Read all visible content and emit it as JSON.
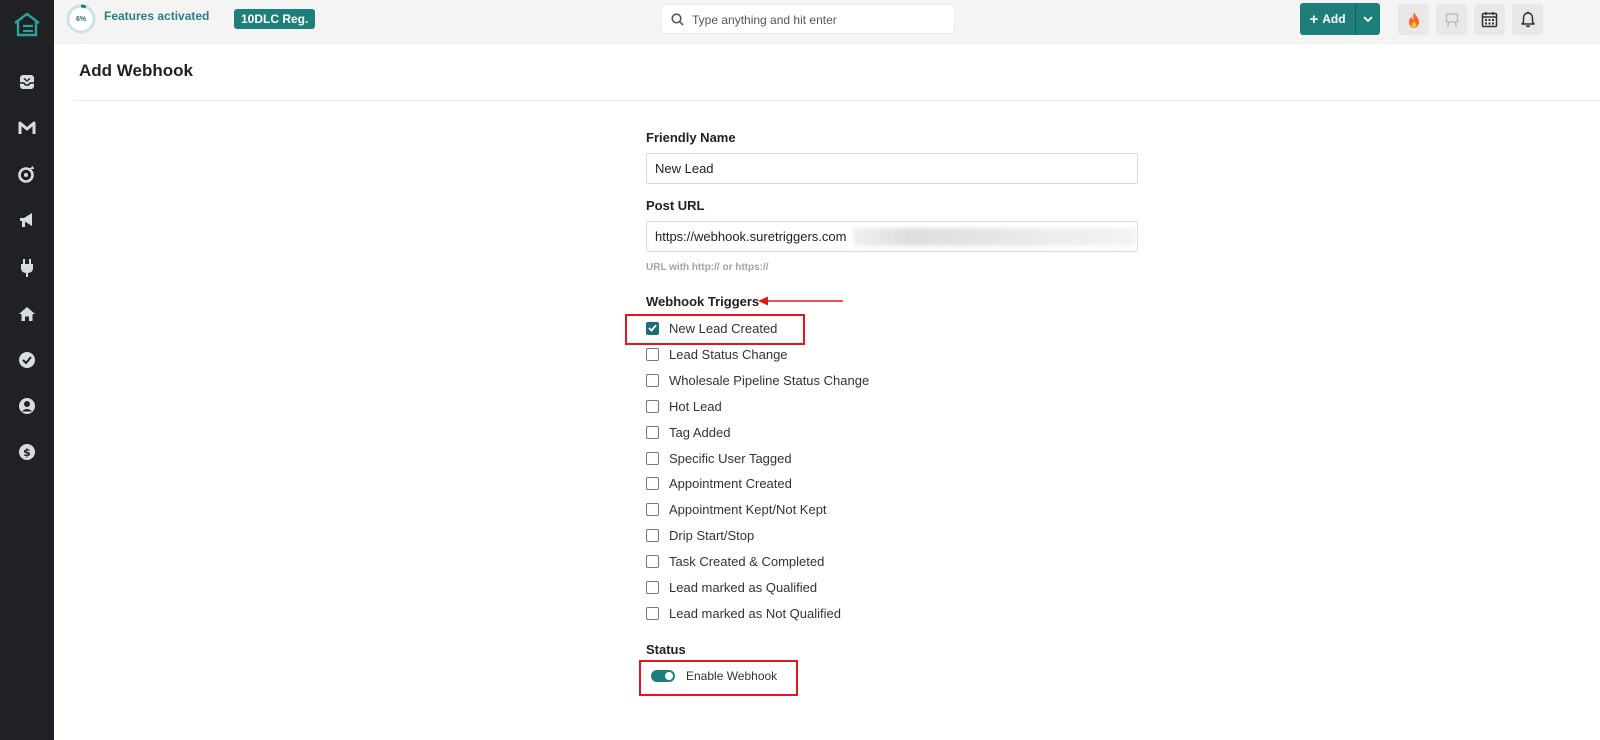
{
  "topbar": {
    "progress_pct": "6%",
    "progress_value": 0.06,
    "features_label": "Features activated",
    "badge_label": "10DLC Reg.",
    "search_placeholder": "Type anything and hit enter",
    "add_label": "Add"
  },
  "sidebar": {
    "items": [
      "inbox-icon",
      "gmail-icon",
      "marketing-icon",
      "megaphone-icon",
      "plugin-icon",
      "home-icon",
      "check-circle-icon",
      "user-icon",
      "dollar-icon"
    ]
  },
  "page": {
    "title": "Add Webhook"
  },
  "form": {
    "friendly_name_label": "Friendly Name",
    "friendly_name_value": "New Lead",
    "post_url_label": "Post URL",
    "post_url_value": "https://webhook.suretriggers.com",
    "post_url_hint": "URL with http:// or https://",
    "triggers_label": "Webhook Triggers",
    "triggers": [
      {
        "label": "New Lead Created",
        "checked": true
      },
      {
        "label": "Lead Status Change",
        "checked": false
      },
      {
        "label": "Wholesale Pipeline Status Change",
        "checked": false
      },
      {
        "label": "Hot Lead",
        "checked": false
      },
      {
        "label": "Tag Added",
        "checked": false
      },
      {
        "label": "Specific User Tagged",
        "checked": false
      },
      {
        "label": "Appointment Created",
        "checked": false
      },
      {
        "label": "Appointment Kept/Not Kept",
        "checked": false
      },
      {
        "label": "Drip Start/Stop",
        "checked": false
      },
      {
        "label": "Task Created & Completed",
        "checked": false
      },
      {
        "label": "Lead marked as Qualified",
        "checked": false
      },
      {
        "label": "Lead marked as Not Qualified",
        "checked": false
      }
    ],
    "status_label": "Status",
    "enable_label": "Enable Webhook",
    "enabled": true
  },
  "colors": {
    "brand": "#1e7f7a",
    "sidebar": "#1f2124",
    "highlight": "#e8141a"
  }
}
